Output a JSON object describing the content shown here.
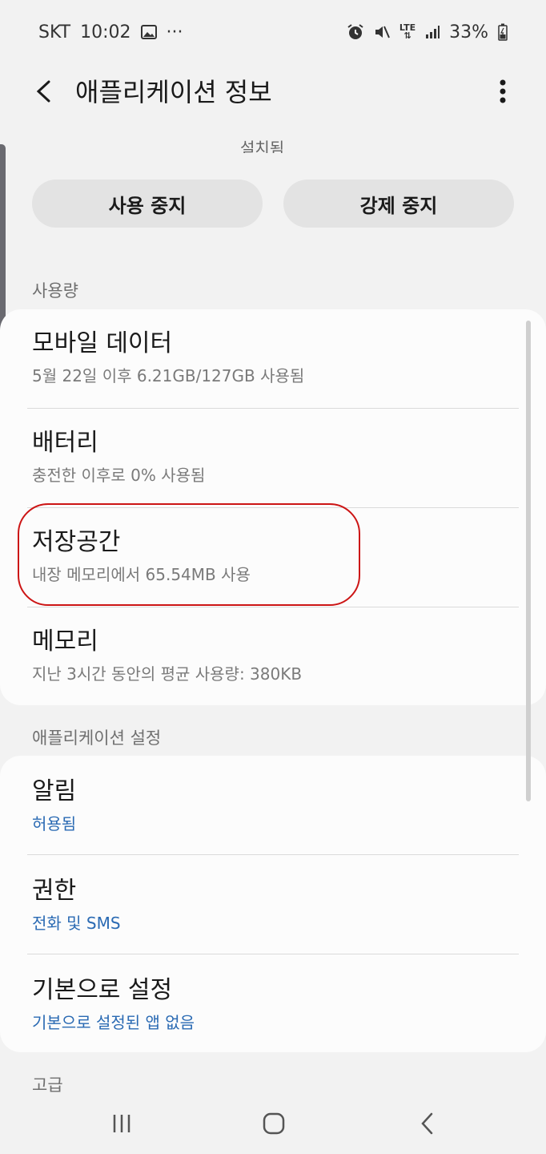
{
  "status_bar": {
    "carrier": "SKT",
    "time": "10:02",
    "more": "···",
    "network": "LTE",
    "battery": "33%"
  },
  "appbar": {
    "title": "애플리케이션 정보"
  },
  "cut_text": "설치됨",
  "buttons": {
    "stop": "사용 중지",
    "force_stop": "강제 중지"
  },
  "usage": {
    "section_label": "사용량",
    "items": [
      {
        "title": "모바일 데이터",
        "subtitle": "5월 22일 이후 6.21GB/127GB 사용됨"
      },
      {
        "title": "배터리",
        "subtitle": "충전한 이후로 0% 사용됨"
      },
      {
        "title": "저장공간",
        "subtitle": "내장 메모리에서 65.54MB 사용"
      },
      {
        "title": "메모리",
        "subtitle": "지난 3시간 동안의 평균 사용량: 380KB"
      }
    ]
  },
  "app_settings": {
    "section_label": "애플리케이션 설정",
    "items": [
      {
        "title": "알림",
        "subtitle": "허용됨"
      },
      {
        "title": "권한",
        "subtitle": "전화 및 SMS"
      },
      {
        "title": "기본으로 설정",
        "subtitle": "기본으로 설정된 앱 없음"
      }
    ]
  },
  "advanced": {
    "section_label": "고급"
  },
  "colors": {
    "accent_link": "#2a6ab3",
    "highlight": "#cc1515"
  }
}
